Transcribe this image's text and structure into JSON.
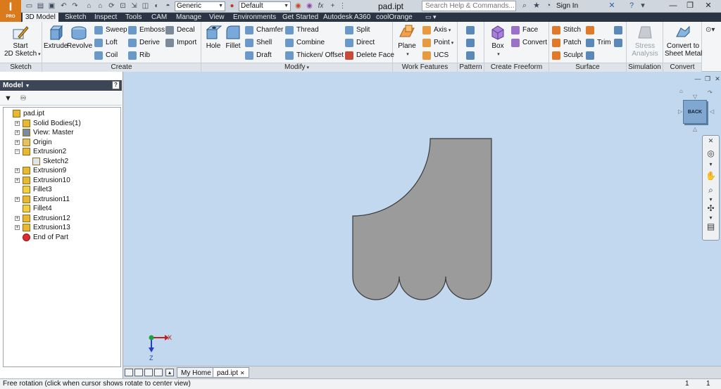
{
  "titlebar": {
    "logo_text": "I",
    "logo_sub": "PRO",
    "appearance_combo": "Generic",
    "style_combo": "Default",
    "formula_symbol": "fx",
    "document_title": "pad.ipt",
    "search_placeholder": "Search Help & Commands...",
    "sign_in": "Sign In",
    "help_symbol": "?"
  },
  "tabs": [
    {
      "label": "3D Model",
      "active": true
    },
    {
      "label": "Sketch"
    },
    {
      "label": "Inspect"
    },
    {
      "label": "Tools"
    },
    {
      "label": "CAM"
    },
    {
      "label": "Manage"
    },
    {
      "label": "View"
    },
    {
      "label": "Environments"
    },
    {
      "label": "Get Started"
    },
    {
      "label": "Autodesk A360"
    },
    {
      "label": "coolOrange"
    }
  ],
  "ribbon": {
    "sketch": {
      "panel_label": "Sketch",
      "start_sketch_line1": "Start",
      "start_sketch_line2": "2D Sketch"
    },
    "create": {
      "panel_label": "Create",
      "extrude": "Extrude",
      "revolve": "Revolve",
      "sweep": "Sweep",
      "emboss": "Emboss",
      "decal": "Decal",
      "loft": "Loft",
      "derive": "Derive",
      "import": "Import",
      "coil": "Coil",
      "rib": "Rib"
    },
    "modify": {
      "panel_label": "Modify",
      "hole": "Hole",
      "fillet": "Fillet",
      "chamfer": "Chamfer",
      "thread": "Thread",
      "shell": "Shell",
      "combine": "Combine",
      "draft": "Draft",
      "thicken_offset": "Thicken/ Offset",
      "split": "Split",
      "direct": "Direct",
      "delete_face": "Delete Face"
    },
    "work_features": {
      "panel_label": "Work Features",
      "plane": "Plane",
      "axis": "Axis",
      "point": "Point",
      "ucs": "UCS"
    },
    "pattern": {
      "panel_label": "Pattern"
    },
    "freeform": {
      "panel_label": "Create Freeform",
      "box": "Box",
      "face": "Face",
      "convert": "Convert"
    },
    "surface": {
      "panel_label": "Surface",
      "stitch": "Stitch",
      "patch": "Patch",
      "trim": "Trim",
      "sculpt": "Sculpt"
    },
    "simulation": {
      "panel_label": "Simulation",
      "stress_line1": "Stress",
      "stress_line2": "Analysis"
    },
    "convert": {
      "panel_label": "Convert",
      "csm_line1": "Convert to",
      "csm_line2": "Sheet Metal"
    }
  },
  "browser": {
    "title": "Model",
    "help_symbol": "?",
    "tree": [
      {
        "label": "pad.ipt"
      },
      {
        "label": "Solid Bodies(1)"
      },
      {
        "label": "View: Master"
      },
      {
        "label": "Origin"
      },
      {
        "label": "Extrusion2"
      },
      {
        "label": "Sketch2"
      },
      {
        "label": "Extrusion9"
      },
      {
        "label": "Extrusion10"
      },
      {
        "label": "Fillet3"
      },
      {
        "label": "Extrusion11"
      },
      {
        "label": "Fillet4"
      },
      {
        "label": "Extrusion12"
      },
      {
        "label": "Extrusion13"
      },
      {
        "label": "End of Part"
      }
    ]
  },
  "viewport": {
    "background_color": "#c2d8ee",
    "part_color": "#9b9b9b",
    "viewcube_face": "BACK",
    "triad_x": "X",
    "triad_z": "Z"
  },
  "doc_tabs": {
    "home": "My Home",
    "part": "pad.ipt"
  },
  "status": {
    "message": "Free rotation (click when cursor shows rotate to center view)",
    "count1": "1",
    "count2": "1"
  }
}
